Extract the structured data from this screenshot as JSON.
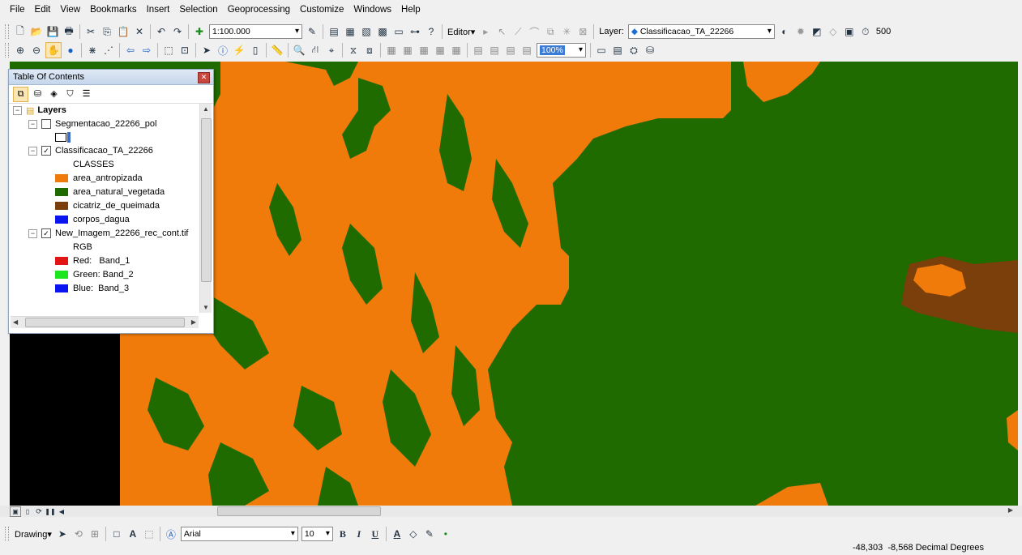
{
  "menu": [
    "File",
    "Edit",
    "View",
    "Bookmarks",
    "Insert",
    "Selection",
    "Geoprocessing",
    "Customize",
    "Windows",
    "Help"
  ],
  "toolbar": {
    "scale": "1:100.000",
    "editor_label": "Editor▾",
    "layer_label": "Layer:",
    "layer_value": "Classificacao_TA_22266",
    "value_500": "500",
    "transparency": "100%"
  },
  "toc": {
    "title": "Table Of Contents",
    "root": "Layers",
    "layers": [
      {
        "name": "Segmentacao_22266_pol",
        "checked": false
      },
      {
        "name": "Classificacao_TA_22266",
        "checked": true,
        "heading": "CLASSES",
        "classes": [
          {
            "label": "area_antropizada",
            "color": "#f07a0a"
          },
          {
            "label": "area_natural_vegetada",
            "color": "#1f6b00"
          },
          {
            "label": "cicatriz_de_queimada",
            "color": "#7a3f0a"
          },
          {
            "label": "corpos_dagua",
            "color": "#0a14f0"
          }
        ]
      },
      {
        "name": "New_Imagem_22266_rec_cont.tif",
        "checked": true,
        "heading": "RGB",
        "bands": [
          {
            "label": "Red:   Band_1",
            "color": "#e31414"
          },
          {
            "label": "Green: Band_2",
            "color": "#1ee61e"
          },
          {
            "label": "Blue:  Band_3",
            "color": "#0a14f0"
          }
        ]
      }
    ]
  },
  "drawing": {
    "label": "Drawing▾",
    "font": "Arial",
    "size": "10",
    "bold": "B",
    "italic": "I",
    "underline": "U",
    "font_color": "A"
  },
  "status": {
    "coords": "-48,303  -8,568 Decimal Degrees"
  },
  "colors": {
    "anthropic": "#f07a0a",
    "vegetation": "#1f6b00",
    "burn": "#7a3f0a",
    "nodata": "#000000"
  }
}
